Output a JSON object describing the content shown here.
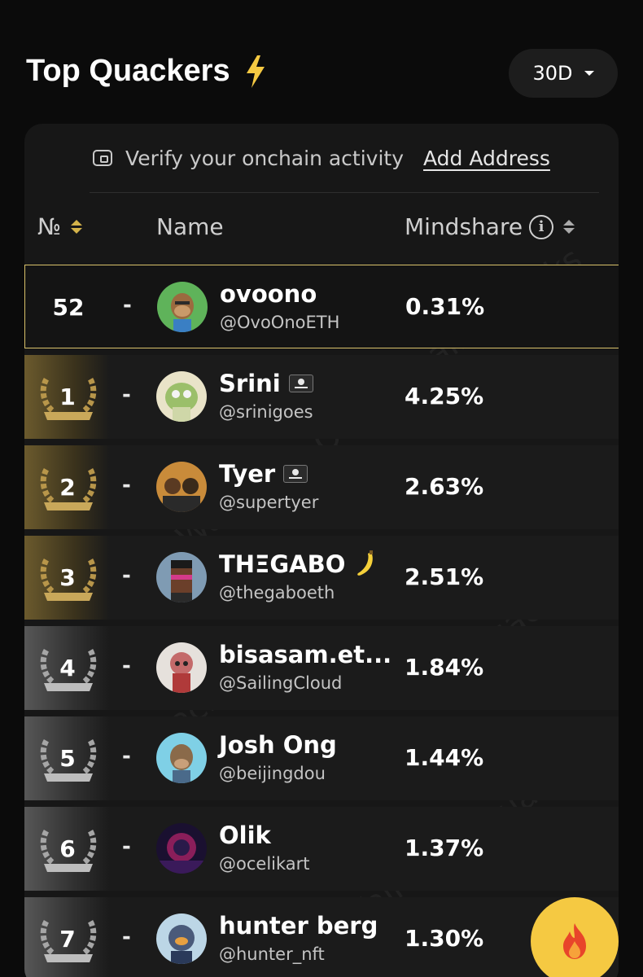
{
  "header": {
    "title": "Top Quackers"
  },
  "period_select": {
    "value": "30D"
  },
  "verify_bar": {
    "text": "Verify your onchain activity",
    "link_label": "Add Address"
  },
  "table": {
    "columns": {
      "rank": "№",
      "name": "Name",
      "mindshare": "Mindshare"
    },
    "current_user": {
      "rank": "52",
      "dash": "-",
      "name": "ovoono",
      "handle": "@OvoOnoETH",
      "share": "0.31%"
    },
    "rows": [
      {
        "rank": "1",
        "tier": "gold",
        "dash": "-",
        "name": "Srini",
        "handle": "@srinigoes",
        "share": "4.25%",
        "badge": "pirate-flag"
      },
      {
        "rank": "2",
        "tier": "gold",
        "dash": "-",
        "name": "Tyer",
        "handle": "@supertyer",
        "share": "2.63%",
        "badge": "pirate-flag"
      },
      {
        "rank": "3",
        "tier": "gold",
        "dash": "-",
        "name": "THΞGABO",
        "handle": "@thegaboeth",
        "share": "2.51%",
        "badge": "banana"
      },
      {
        "rank": "4",
        "tier": "silver",
        "dash": "-",
        "name": "bisasam.et...",
        "handle": "@SailingCloud",
        "share": "1.84%"
      },
      {
        "rank": "5",
        "tier": "silver",
        "dash": "-",
        "name": "Josh Ong",
        "handle": "@beijingdou",
        "share": "1.44%"
      },
      {
        "rank": "6",
        "tier": "silver",
        "dash": "-",
        "name": "Olik",
        "handle": "@ocelikart",
        "share": "1.37%"
      },
      {
        "rank": "7",
        "tier": "silver",
        "dash": "-",
        "name": "hunter berg",
        "handle": "@hunter_nft",
        "share": "1.30%"
      }
    ]
  },
  "watermark": {
    "text": "Wallchain Quacks",
    "domain": "quacks.app"
  },
  "colors": {
    "accent": "#f5c942",
    "highlight_border": "#d9c26a",
    "gold": "#d4b34a",
    "background": "#0b0b0b",
    "panel": "#171717"
  },
  "icons": {
    "title": "lightning-bolt-icon",
    "period": "chevron-down-icon",
    "verify": "wallet-icon",
    "info": "info-icon",
    "fab": "fire-icon"
  }
}
